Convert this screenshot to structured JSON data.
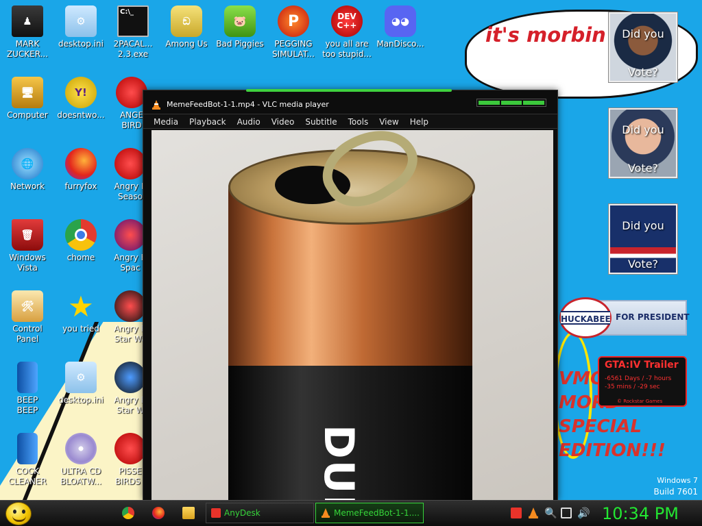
{
  "wallpaper": {
    "speech_text": "it's morbin t",
    "morbius_lines": [
      "VMO",
      "MORB",
      "SPECIAL",
      "EDITION!!!"
    ],
    "windows_label": "Windows 7",
    "build_label": "Build 7601"
  },
  "desktop_icons": [
    {
      "label": "MARK\nZUCKER..."
    },
    {
      "label": "desktop.ini"
    },
    {
      "label": "2PACAL...\n2.3.exe"
    },
    {
      "label": "Among Us"
    },
    {
      "label": "Bad Piggies"
    },
    {
      "label": "PEGGING\nSIMULAT..."
    },
    {
      "label": "you all are\ntoo stupid..."
    },
    {
      "label": "ManDisco..."
    },
    {
      "label": "Computer"
    },
    {
      "label": "doesntwo..."
    },
    {
      "label": "ANGE\nBIRD"
    },
    {
      "label": "Network"
    },
    {
      "label": "furryfox"
    },
    {
      "label": "Angry E\nSeaso"
    },
    {
      "label": "Windows\nVista"
    },
    {
      "label": "chome"
    },
    {
      "label": "Angry B\nSpac"
    },
    {
      "label": "Control\nPanel"
    },
    {
      "label": "you tried"
    },
    {
      "label": "Angry B\nStar Wa"
    },
    {
      "label": "BEEP\nBEEP"
    },
    {
      "label": "desktop.ini"
    },
    {
      "label": "Angry B\nStar W"
    },
    {
      "label": "COCK\nCLEANER"
    },
    {
      "label": "ULTRA CD\nBLOATW..."
    },
    {
      "label": "PISSE\nBIRDS I"
    }
  ],
  "vote_widgets": {
    "line1": "Did you",
    "line2": "Vote?"
  },
  "huckabee": {
    "name": "HUCKABEE",
    "tagline": "FOR PRESIDENT"
  },
  "gta": {
    "title": "GTA:IV Trailer",
    "line1": "-6561 Days / -7 hours",
    "line2": "-35 mins / -29 sec",
    "credit": "© Rockstar Games"
  },
  "vlc": {
    "title": "MemeFeedBot-1-1.mp4 - VLC media player",
    "menu": [
      "Media",
      "Playback",
      "Audio",
      "Video",
      "Subtitle",
      "Tools",
      "View",
      "Help"
    ],
    "video_text": "DUR"
  },
  "taskbar": {
    "buttons": [
      {
        "label": "AnyDesk"
      },
      {
        "label": "MemeFeedBot-1-1...."
      }
    ],
    "clock": "10:34 PM"
  }
}
